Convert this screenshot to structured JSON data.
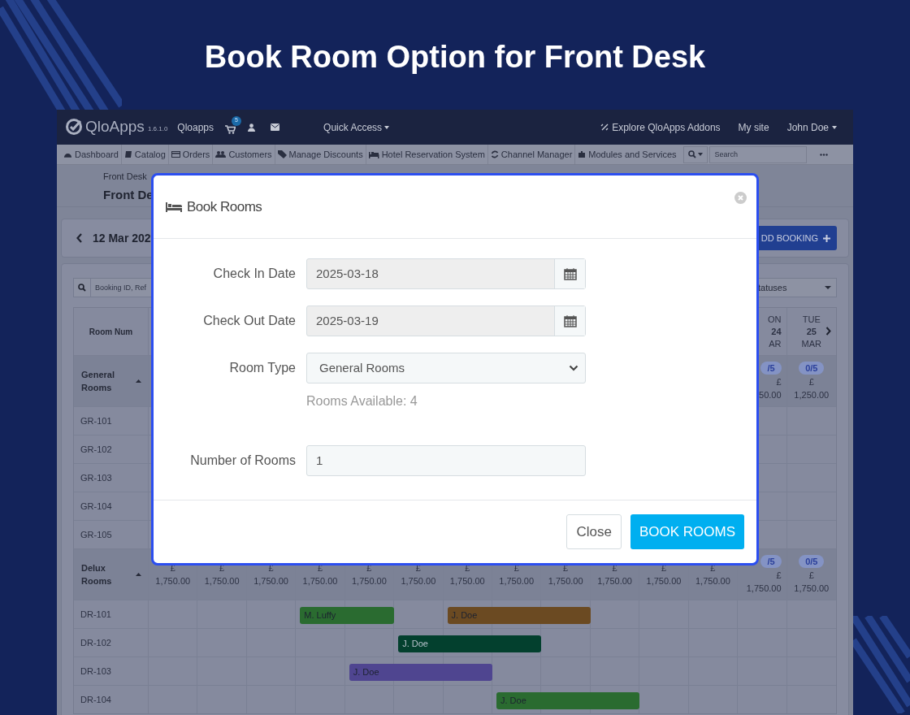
{
  "headline": "Book Room Option for Front Desk",
  "topbar": {
    "logo": "QloApps",
    "version": "1.6.1.0",
    "shop": "Qloapps",
    "cart_count": "5",
    "quick_access": "Quick Access",
    "links": [
      "Explore QloApps Addons",
      "My site"
    ],
    "user": "John Doe"
  },
  "menu": [
    "Dashboard",
    "Catalog",
    "Orders",
    "Customers",
    "Manage Discounts",
    "Hotel Reservation System",
    "Channel Manager",
    "Modules and Services"
  ],
  "search": {
    "placeholder": "Search"
  },
  "breadcrumb": "Front Desk",
  "page_title": "Front De",
  "toolbar": {
    "date": "12 Mar 202",
    "add_button": "DD BOOKING"
  },
  "filter": {
    "placeholder": "Booking ID, Ref",
    "status": "tatuses"
  },
  "table": {
    "first_column": "Room Num",
    "days": [
      {
        "weekday": "ON",
        "day": "24",
        "month": "AR"
      },
      {
        "weekday": "TUE",
        "day": "25",
        "month": "MAR"
      }
    ],
    "groups": [
      {
        "name": "General Rooms",
        "cells": [
          {
            "count": "/5",
            "currency": "£",
            "price": "50.00"
          },
          {
            "count": "0/5",
            "currency": "£",
            "price": "1,250.00"
          }
        ],
        "rooms": [
          {
            "room": "GR-101"
          },
          {
            "room": "GR-102"
          },
          {
            "room": "GR-103"
          },
          {
            "room": "GR-104"
          },
          {
            "room": "GR-105"
          }
        ]
      },
      {
        "name": "Delux Rooms",
        "cells": [
          {
            "currency": "£",
            "price": "1,750.00"
          },
          {
            "currency": "£",
            "price": "1,750.00"
          },
          {
            "currency": "£",
            "price": "1,750.00"
          },
          {
            "currency": "£",
            "price": "1,750.00"
          },
          {
            "currency": "£",
            "price": "1,750.00"
          },
          {
            "currency": "£",
            "price": "1,750.00"
          },
          {
            "currency": "£",
            "price": "1,750.00"
          },
          {
            "currency": "£",
            "price": "1,750.00"
          },
          {
            "currency": "£",
            "price": "1,750.00"
          },
          {
            "currency": "£",
            "price": "1,750.00"
          },
          {
            "currency": "£",
            "price": "1,750.00"
          },
          {
            "currency": "£",
            "price": "1,750.00"
          },
          {
            "count": "/5",
            "currency": "£",
            "price": "1,750.00"
          },
          {
            "count": "0/5",
            "currency": "£",
            "price": "1,750.00"
          }
        ],
        "rooms": [
          {
            "room": "DR-101",
            "bookings": [
              {
                "guest": "M. Luffy",
                "color": "#2a6b30"
              },
              {
                "guest": "J. Doe",
                "color": "#6b4a22"
              }
            ]
          },
          {
            "room": "DR-102",
            "bookings": [
              {
                "guest": "J. Doe",
                "color": "#03402e"
              }
            ]
          },
          {
            "room": "DR-103",
            "bookings": [
              {
                "guest": "J. Doe",
                "color": "#4f4590"
              }
            ]
          },
          {
            "room": "DR-104",
            "bookings": [
              {
                "guest": "J. Doe",
                "color": "#2a6b30"
              }
            ]
          }
        ]
      }
    ]
  },
  "modal": {
    "title": "Book Rooms",
    "fields": [
      {
        "label": "Check In Date",
        "kind": "date",
        "value": "2025-03-18"
      },
      {
        "label": "Check Out Date",
        "kind": "date",
        "value": "2025-03-19"
      },
      {
        "label": "Room Type",
        "kind": "select",
        "value": "General Rooms",
        "note": "Rooms Available: 4"
      },
      {
        "label": "Number of Rooms",
        "kind": "number",
        "value": "1"
      }
    ],
    "buttons": [
      {
        "label": "Close",
        "kind": "secondary"
      },
      {
        "label": "BOOK ROOMS",
        "kind": "primary"
      }
    ]
  }
}
